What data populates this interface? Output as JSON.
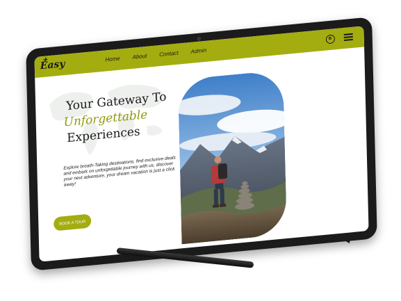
{
  "brand": {
    "name": "Easy"
  },
  "nav": {
    "links": [
      "Home",
      "About",
      "Contact",
      "Admin"
    ]
  },
  "hero": {
    "title_line1": "Your Gateway To",
    "title_line2": "Unforgettable",
    "title_line3": "Experiences",
    "description": "Explore breath-Taking destinations, find exclusive deals and embark on unforgettable journey with us, discover your next adventure, your dream vacation is just a click away!",
    "cta_label": "BOOK A TOUR"
  },
  "colors": {
    "accent": "#a4ad0f",
    "accent_text": "#8f9a0c",
    "bezel": "#1b1b1b"
  },
  "icons": [
    "user-icon",
    "menu-icon",
    "plane-icon"
  ]
}
